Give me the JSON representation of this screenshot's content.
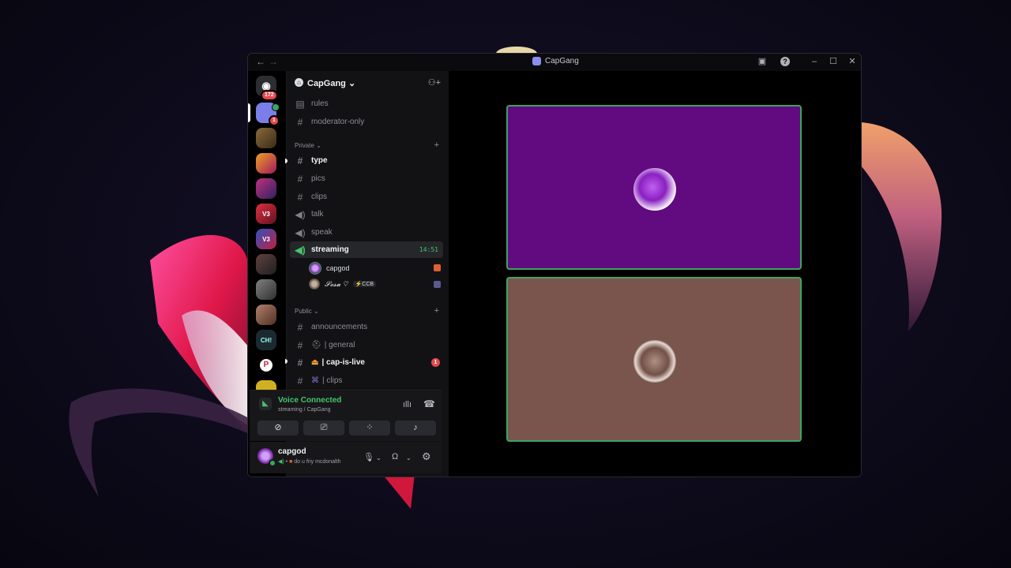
{
  "window": {
    "title": "CapGang",
    "nav_back": "←",
    "nav_forward": "→",
    "controls": [
      "inbox-icon",
      "help-icon",
      "minimize-icon",
      "maximize-icon",
      "close-icon"
    ]
  },
  "servers": {
    "dm_badge": "172",
    "selected_badge": "1",
    "labels": [
      "V3",
      "V3",
      "CH!",
      "P"
    ]
  },
  "server_header": {
    "name": "CapGang",
    "chevron": "⌄"
  },
  "channels_top": [
    {
      "name": "rules",
      "icon": "rules-icon"
    },
    {
      "name": "moderator-only",
      "icon": "hash-icon"
    }
  ],
  "private": {
    "label": "Private ⌄",
    "channels": [
      {
        "name": "type",
        "icon": "hash-icon"
      },
      {
        "name": "pics",
        "icon": "hash-icon"
      },
      {
        "name": "clips",
        "icon": "hash-icon"
      },
      {
        "name": "talk",
        "icon": "speaker-icon"
      },
      {
        "name": "speak",
        "icon": "speaker-icon"
      },
      {
        "name": "streaming",
        "icon": "speaker-icon",
        "time": "14:51"
      }
    ],
    "voice_users": [
      {
        "name": "capgod"
      },
      {
        "name": "𝓢𝓸𝓼𝓪 ♡",
        "tag": "⚡CCB"
      }
    ]
  },
  "public": {
    "label": "Public ⌄",
    "channels": [
      {
        "name": "announcements",
        "icon": "hash-icon"
      },
      {
        "name": "| general",
        "icon": "hash-icon"
      },
      {
        "name": "| cap-is-live",
        "icon": "hash-icon",
        "badge": "1"
      },
      {
        "name": "| clips",
        "icon": "hash-icon"
      }
    ]
  },
  "voice_panel": {
    "title": "Voice Connected",
    "subtitle": "streaming / CapGang"
  },
  "user_panel": {
    "name": "capgod",
    "status": "do u friy mcdonalth"
  },
  "colors": {
    "accent_green": "#3ba55d",
    "tile_1": "#620a80",
    "tile_2": "#7a554d"
  }
}
